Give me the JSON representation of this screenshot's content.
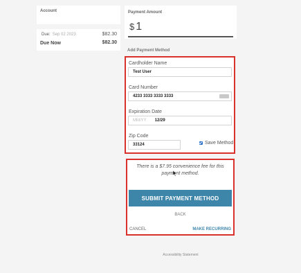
{
  "account": {
    "label": "Account"
  },
  "due": {
    "row1_label": "Due:",
    "row1_date": "Sep 02 2023",
    "row1_amount": "$82.30",
    "row2_label": "Due Now",
    "row2_amount": "$82.30"
  },
  "payment_amount": {
    "label": "Payment Amount",
    "currency": "$",
    "value": "1"
  },
  "add_method_label": "Add Payment Method",
  "form": {
    "cardholder_label": "Cardholder Name",
    "cardholder_value": "Test User",
    "card_number_label": "Card Number",
    "card_number_value": "4233 3333 3333 3333",
    "expiration_label": "Expiration Date",
    "expiration_placeholder": "MM/YY",
    "expiration_value": "12/29",
    "zip_label": "Zip Code",
    "zip_value": "33124",
    "save_method_label": "Save Method",
    "save_method_checked": true
  },
  "submit": {
    "fee_text": "There is a $7.95 convenience fee for this payment method.",
    "submit_label": "SUBMIT PAYMENT METHOD",
    "back_label": "BACK",
    "cancel_label": "CANCEL",
    "recurring_label": "MAKE RECURRING"
  },
  "footer": {
    "accessibility_label": "Accessibility Statement"
  },
  "colors": {
    "accent": "#3d86aa",
    "highlight_border": "#d9302c",
    "checkbox": "#2a6fc9"
  },
  "icons": {
    "card_brand": "card-brand-icon",
    "checkbox": "checkbox-checked-icon",
    "cursor": "mouse-cursor-icon"
  }
}
